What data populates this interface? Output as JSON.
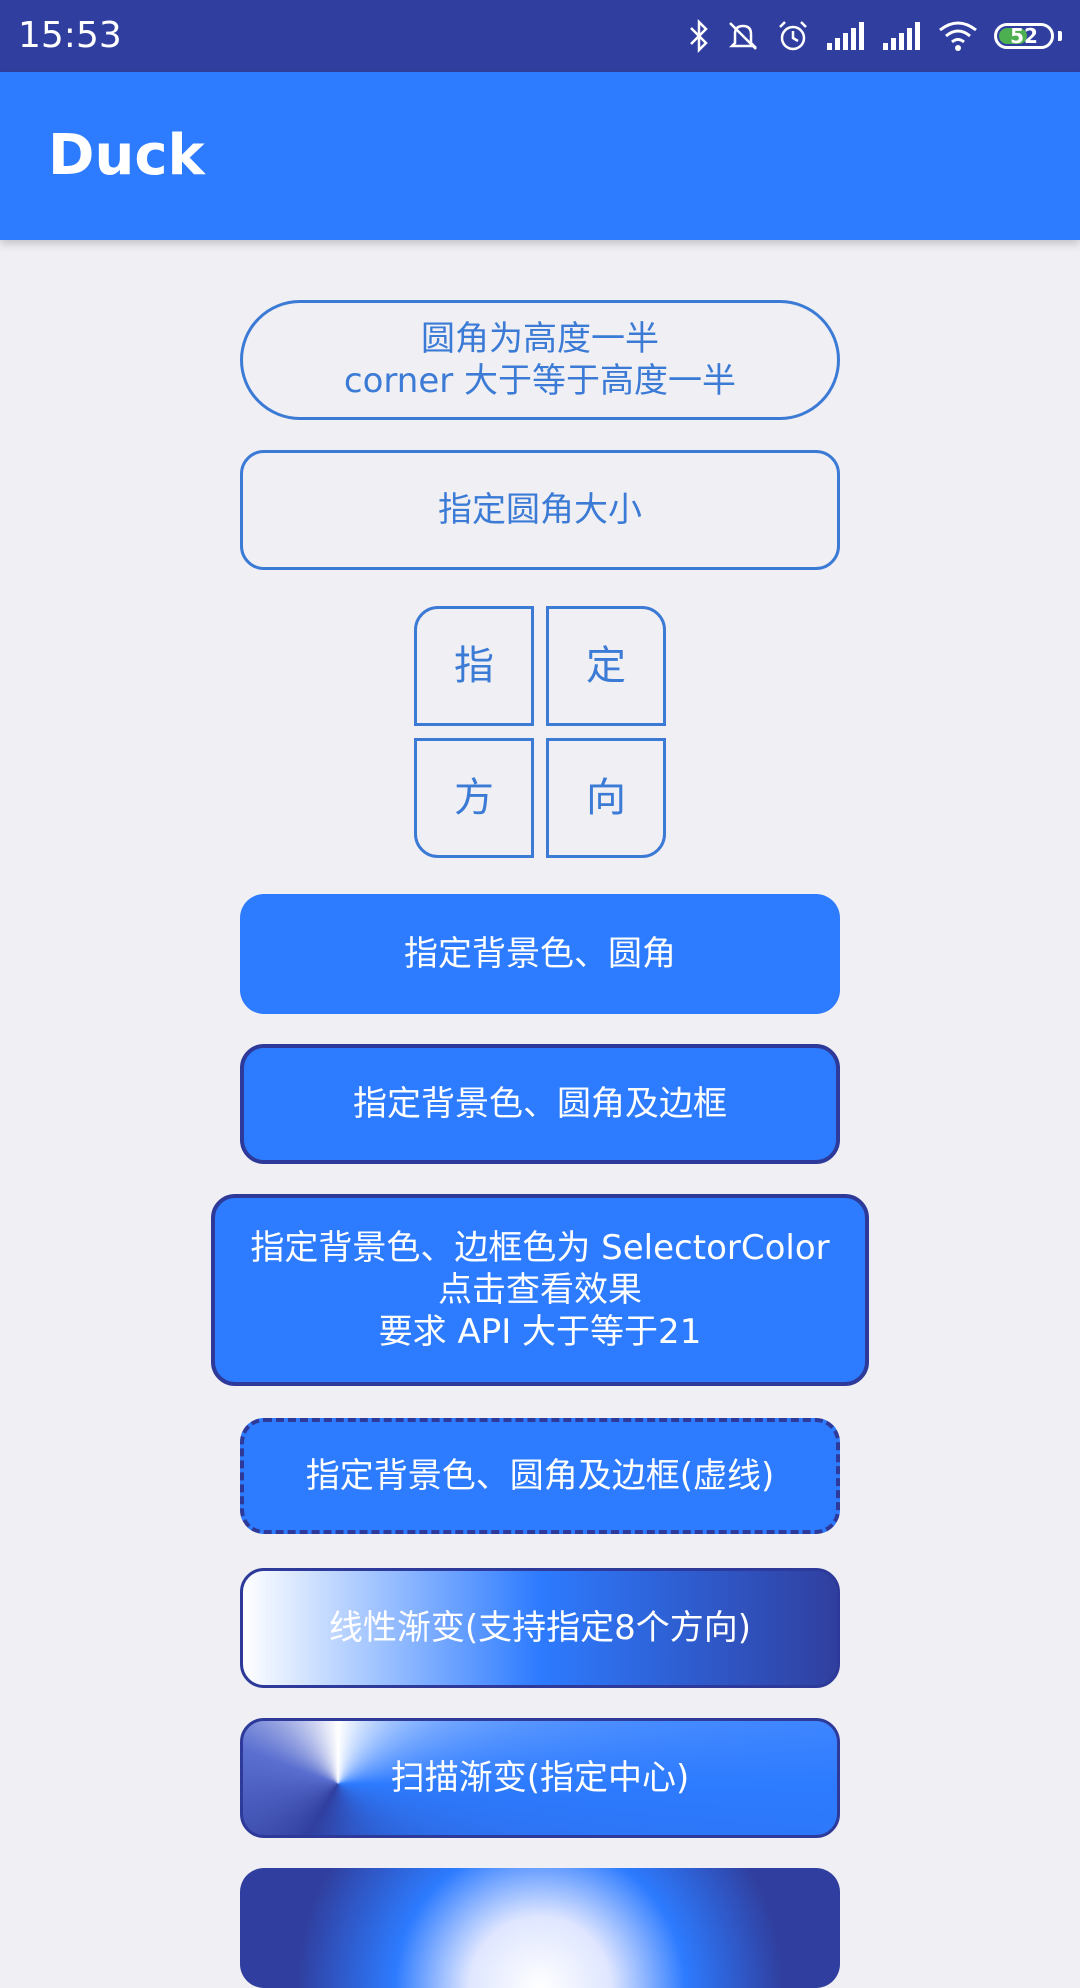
{
  "status_bar": {
    "time": "15:53",
    "battery": "52",
    "icons": [
      "bluetooth-icon",
      "mute-icon",
      "alarm-icon",
      "signal-icon",
      "signal-icon",
      "wifi-icon",
      "battery-icon"
    ]
  },
  "app_bar": {
    "title": "Duck"
  },
  "buttons": {
    "half_height_corner": "圆角为高度一半\ncorner 大于等于高度一半",
    "specified_corner": "指定圆角大小",
    "direction_1": "指",
    "direction_2": "定",
    "direction_3": "方",
    "direction_4": "向",
    "bg_color_corner": "指定背景色、圆角",
    "bg_color_corner_border": "指定背景色、圆角及边框",
    "selector_color": "指定背景色、边框色为 SelectorColor\n点击查看效果\n要求 API 大于等于21",
    "dashed_border": "指定背景色、圆角及边框(虚线)",
    "linear_gradient": "线性渐变(支持指定8个方向)",
    "sweep_gradient": "扫描渐变(指定中心)",
    "radial_gradient": ""
  },
  "colors": {
    "status_bar": "#303f9f",
    "app_bar": "#2d7bff",
    "accent": "#3b7bd6",
    "border_dark": "#2e3a9a",
    "background": "#efeff4"
  }
}
